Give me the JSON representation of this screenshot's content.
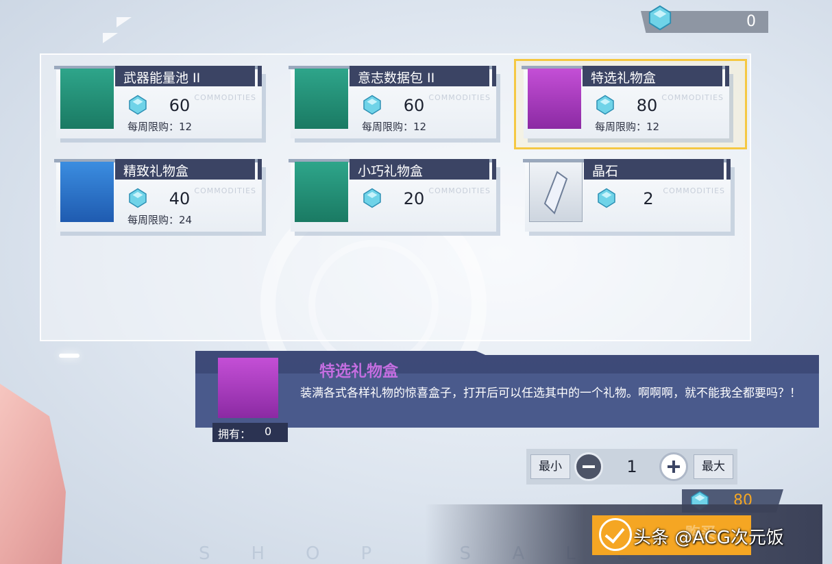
{
  "currency": {
    "amount": "0",
    "icon": "crystal-gem-icon"
  },
  "items": [
    {
      "name": "武器能量池 II",
      "price": "60",
      "limit": "每周限购：12",
      "thumb": "green",
      "watermark": "COMMODITIES"
    },
    {
      "name": "意志数据包 II",
      "price": "60",
      "limit": "每周限购：12",
      "thumb": "green",
      "watermark": "COMMODITIES"
    },
    {
      "name": "特选礼物盒",
      "price": "80",
      "limit": "每周限购：12",
      "thumb": "purple",
      "watermark": "COMMODITIES",
      "selected": true
    },
    {
      "name": "精致礼物盒",
      "price": "40",
      "limit": "每周限购：24",
      "thumb": "blue",
      "watermark": "COMMODITIES"
    },
    {
      "name": "小巧礼物盒",
      "price": "20",
      "limit": "",
      "thumb": "green",
      "watermark": "COMMODITIES"
    },
    {
      "name": "晶石",
      "price": "2",
      "limit": "",
      "thumb": "grey",
      "watermark": "COMMODITIES"
    }
  ],
  "detail": {
    "title": "特选礼物盒",
    "description": "装满各式各样礼物的惊喜盒子，打开后可以任选其中的一个礼物。啊啊啊，就不能我全都要吗？！",
    "owned_label": "拥有：",
    "owned_value": "0"
  },
  "quantity": {
    "min_label": "最小",
    "max_label": "最大",
    "value": "1"
  },
  "total": {
    "cost": "80"
  },
  "buy": {
    "label": "购买"
  },
  "overlay": {
    "watermark": "头条 @ACG次元饭"
  },
  "background": {
    "footer_text": "SHOP SALE"
  },
  "colors": {
    "accent": "#f5a623",
    "selected_border": "#f5c842",
    "title_bar": "#3b4464",
    "detail_title": "#c36ee0"
  }
}
